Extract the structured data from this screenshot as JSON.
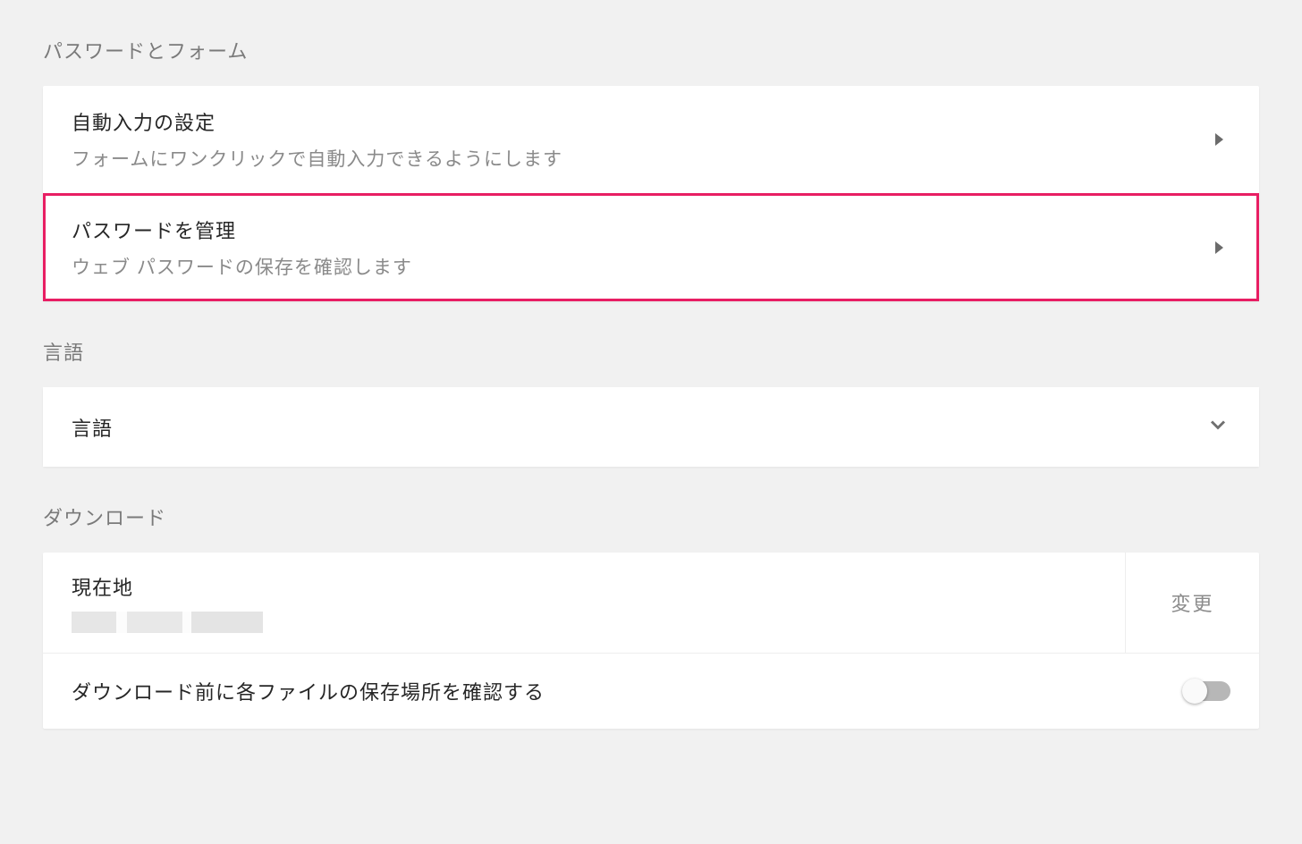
{
  "sections": {
    "passwordsAndForms": {
      "header": "パスワードとフォーム",
      "rows": {
        "autofill": {
          "title": "自動入力の設定",
          "sub": "フォームにワンクリックで自動入力できるようにします"
        },
        "managePasswords": {
          "title": "パスワードを管理",
          "sub": "ウェブ パスワードの保存を確認します"
        }
      }
    },
    "language": {
      "header": "言語",
      "row": {
        "title": "言語"
      }
    },
    "download": {
      "header": "ダウンロード",
      "location": {
        "title": "現在地",
        "changeButton": "変更"
      },
      "askBefore": {
        "title": "ダウンロード前に各ファイルの保存場所を確認する",
        "enabled": false
      }
    }
  }
}
